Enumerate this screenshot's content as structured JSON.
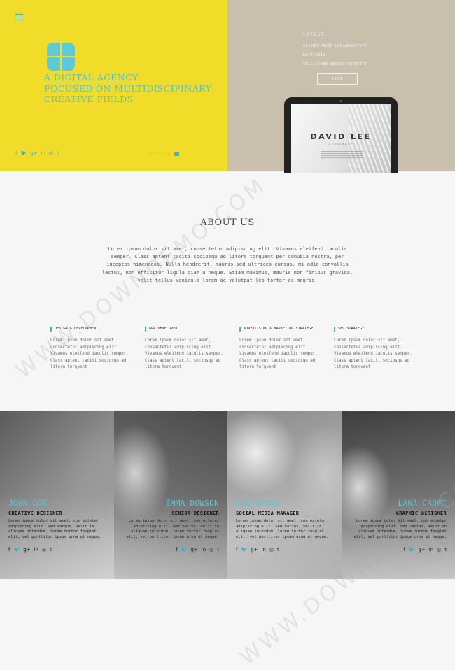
{
  "hero": {
    "tagline": [
      "A DIGITAL ACENCY",
      "FOCUSED ON MULTIDISCIPINARY",
      "CREATIVE FIELDS"
    ],
    "social": [
      "f",
      "🐦",
      "g+",
      "in",
      "◎",
      "t"
    ],
    "contact": [
      "— — — — —",
      "✉"
    ],
    "latest_label": "LATEST",
    "latest_items": [
      "CLIENT/DAVID LEE/ARCHITECT",
      "DATE/2016",
      "SKILLS/WEB DESIGN/IDENTITY"
    ],
    "view_label": "VIEW",
    "tablet_title": "DAVID LEE",
    "tablet_subtitle": "architect",
    "accent_color": "#f2dc2a",
    "secondary_color": "#c8bfac",
    "brand_color": "#4fc3d2"
  },
  "about": {
    "title": "ABOUT US",
    "text": "Lorem ipsum dolor sit amet, consectetur adipiscing elit. Vivamus eleifend iaculis semper. Class aptent taciti sociosqu ad litora torquent per conubia nostra, per inceptos himenaeos. Nulla hendrerit, mauris sed ultrices cursus, mi odio convallis lectus, non efficitur ligula diam a neque. Etiam maximus, mauris non finibus gravida, velit tellus venicula lorem ac volutpat leo tortor ac mauris."
  },
  "services": [
    {
      "title": "DESIGN & DEVELOPMENT",
      "text": "Lorem ipsum dolor sit amet, consectetur adipiscing elit. Vivamus eleifend iaculis semper. Class aptent taciti sociosqu ad litora torquent"
    },
    {
      "title": "APP DEVELOPER",
      "text": "Lorem ipsum dolor sit amet, consectetur adipiscing elit. Vivamus eleifend iaculis semper. Class aptent taciti sociosqu ad litora torquent"
    },
    {
      "title": "ADVERTISING & MARKETING STRATEGY",
      "text": "Lorem ipsum dolor sit amet, consectetur adipiscing elit. Vivamus eleifend iaculis semper. Class aptent taciti sociosqu ad litora torquent"
    },
    {
      "title": "SEO STRATEGY",
      "text": "Lorem ipsum dolor sit amet, consectetur adipiscing elit. Vivamus eleifend iaculis semper. Class aptent taciti sociosqu ad litora torquent"
    }
  ],
  "team": [
    {
      "name": "JOHN DOE",
      "role": "CREATIVE DESIGNER",
      "bio": "Lorem ipsum dolor sit amet, con ectetur adipiscing elit. Sed varius, velit in aliquam interdum, lorem tortor feugiat elit, vel porttitor ipsum urna ut neque."
    },
    {
      "name": "EMMA DOWSON",
      "role": "SENIOR DESIGNER",
      "bio": "Lorem ipsum dolor sit amet, con ectetur adipiscing elit. Sed varius, velit in aliquam interdum, lorem tortor feugiat elit, vel porttitor ipsum urna ut neque."
    },
    {
      "name": "RON BROSS",
      "role": "SOCIAL MEDIA MANAGER",
      "bio": "Lorem ipsum dolor sit amet, con ectetur adipiscing elit. Sed varius, velit in aliquam interdum, lorem tortor feugiat elit, vel porttitor ipsum urna ut neque."
    },
    {
      "name": "LANA CROFT",
      "role": "GRAPHIC DESIGNER",
      "bio": "Lorem ipsum dolor sit amet, con ectetur adipiscing elit. Sed varius, velit in aliquam interdum, lorem tortor feugiat elit, vel porttitor ipsum urna ut neque."
    }
  ],
  "team_social": [
    "f",
    "🐦",
    "g+",
    "in",
    "◎",
    "t"
  ],
  "watermark": "WWW.DOWNDEMO.COM"
}
